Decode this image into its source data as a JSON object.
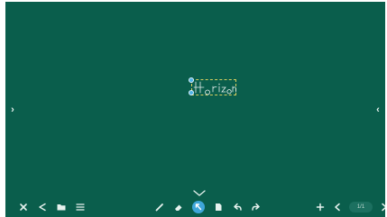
{
  "board": {
    "background": "#0a5e4c"
  },
  "navigation": {
    "left_arrow": "chevron-right-icon",
    "right_arrow": "chevron-left-icon"
  },
  "canvas": {
    "handwriting": "Horizon",
    "selection_color": "#d8d060",
    "handle_color": "#4fb3e6"
  },
  "toolbar": {
    "collapse_icon": "chevron-down-icon",
    "left_tools": [
      "close-icon",
      "share-icon",
      "folder-icon",
      "menu-icon"
    ],
    "center_tools": [
      "pen-icon",
      "eraser-icon",
      "select-icon",
      "page-icon",
      "undo-icon",
      "redo-icon"
    ],
    "active_tool": "select-icon",
    "right_tools": [
      "add-page-icon",
      "previous-page-icon",
      "next-page-icon"
    ],
    "page_indicator": "1/1",
    "accent": "#3ea6d9"
  }
}
